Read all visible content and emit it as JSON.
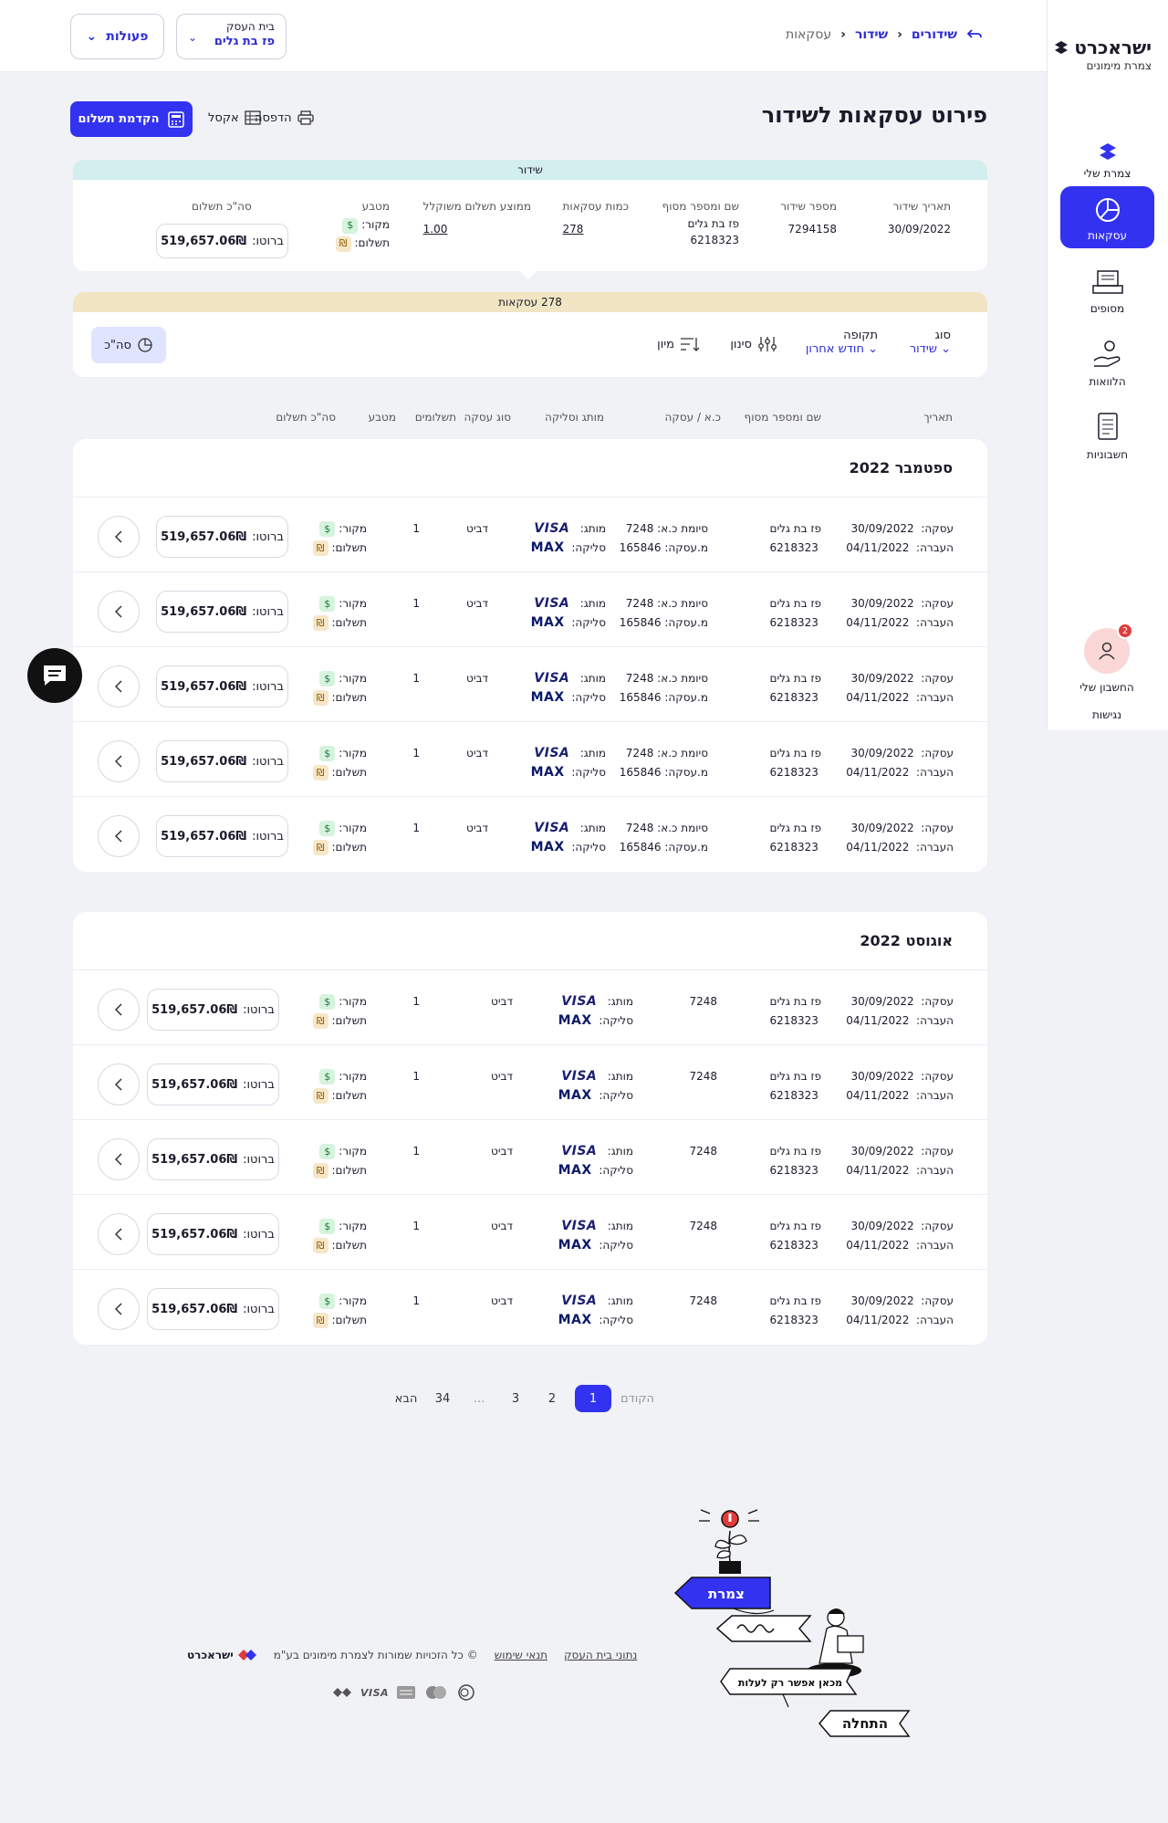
{
  "sidebar": {
    "logo_title": "ישראכרט",
    "logo_sub": "צמרת מימונים",
    "items": [
      {
        "label": "צמרת שלי",
        "icon": "layers-icon"
      },
      {
        "label": "עסקאות",
        "icon": "pie-chart-icon"
      },
      {
        "label": "מסופים",
        "icon": "terminal-icon"
      },
      {
        "label": "הלוואות",
        "icon": "loan-hand-icon"
      },
      {
        "label": "חשבוניות",
        "icon": "invoice-icon"
      }
    ],
    "account_label": "החשבון שלי",
    "account_badge": "2",
    "accessibility": "נגישות"
  },
  "header": {
    "breadcrumb": [
      "שידורים",
      "שידור",
      "עסקאות"
    ],
    "business_label": "בית העסק",
    "business_value": "פז בת גלים",
    "actions_label": "פעולות"
  },
  "toolbar": {
    "title": "פירוט עסקאות לשידור",
    "print": "הדפסה",
    "excel": "אקסל",
    "advance": "הקדמת תשלום"
  },
  "summary": {
    "header": "שידור",
    "date_h": "תאריך שידור",
    "date_v": "30/09/2022",
    "num_h": "מספר שידור",
    "num_v": "7294158",
    "terminal_h": "שם ומספר מסוף",
    "terminal_v1": "פז בת גלים",
    "terminal_v2": "6218323",
    "count_h": "כמות עסקאות",
    "count_v": "278",
    "avg_h": "ממוצע תשלום משוקלל",
    "avg_v": "1.00",
    "currency_h": "מטבע",
    "source": "מקור:",
    "payment": "תשלום:",
    "dollar": "$",
    "shekel": "₪",
    "total_h": "סה\"כ תשלום",
    "gross": "ברוטו:",
    "total_v": "519,657.06₪"
  },
  "filters": {
    "header": "278 עסקאות",
    "type_h": "סוג",
    "type_v": "שידור",
    "period_h": "תקופה",
    "period_v": "חודש אחרון",
    "filter": "סינון",
    "sort": "מיון",
    "total": "סה\"כ"
  },
  "columns": [
    "תאריך",
    "שם ומספר מסוף",
    "כ.א / עסקה",
    "מותג וסליקה",
    "סוג עסקה",
    "תשלומים",
    "מטבע",
    "סה\"כ תשלום"
  ],
  "row_labels": {
    "deal": "עסקה:",
    "transfer": "העברה:",
    "card_end": "סיומת כ.א:",
    "deal_no": "מ.עסקה:",
    "brand": "מותג:",
    "clearing": "סליקה:",
    "visa": "VISA",
    "max": "MAX",
    "source": "מקור:",
    "payment": "תשלום:",
    "gross": "ברוטו:",
    "dollar": "$",
    "shekel": "₪"
  },
  "months": [
    {
      "title": "ספטמבר 2022",
      "rows": [
        {
          "deal_date": "30/09/2022",
          "transfer_date": "04/11/2022",
          "terminal": "פז בת גלים",
          "terminal_no": "6218323",
          "card_end": "7248",
          "deal_no": "165846",
          "type": "דביט",
          "payments": "1",
          "amount": "519,657.06₪"
        },
        {
          "deal_date": "30/09/2022",
          "transfer_date": "04/11/2022",
          "terminal": "פז בת גלים",
          "terminal_no": "6218323",
          "card_end": "7248",
          "deal_no": "165846",
          "type": "דביט",
          "payments": "1",
          "amount": "519,657.06₪"
        },
        {
          "deal_date": "30/09/2022",
          "transfer_date": "04/11/2022",
          "terminal": "פז בת גלים",
          "terminal_no": "6218323",
          "card_end": "7248",
          "deal_no": "165846",
          "type": "דביט",
          "payments": "1",
          "amount": "519,657.06₪"
        },
        {
          "deal_date": "30/09/2022",
          "transfer_date": "04/11/2022",
          "terminal": "פז בת גלים",
          "terminal_no": "6218323",
          "card_end": "7248",
          "deal_no": "165846",
          "type": "דביט",
          "payments": "1",
          "amount": "519,657.06₪"
        },
        {
          "deal_date": "30/09/2022",
          "transfer_date": "04/11/2022",
          "terminal": "פז בת גלים",
          "terminal_no": "6218323",
          "card_end": "7248",
          "deal_no": "165846",
          "type": "דביט",
          "payments": "1",
          "amount": "519,657.06₪"
        }
      ]
    },
    {
      "title": "אוגוסט 2022",
      "rows": [
        {
          "deal_date": "30/09/2022",
          "transfer_date": "04/11/2022",
          "terminal": "פז בת גלים",
          "terminal_no": "6218323",
          "card_end": "7248",
          "type": "דביט",
          "payments": "1",
          "amount": "519,657.06₪"
        },
        {
          "deal_date": "30/09/2022",
          "transfer_date": "04/11/2022",
          "terminal": "פז בת גלים",
          "terminal_no": "6218323",
          "card_end": "7248",
          "type": "דביט",
          "payments": "1",
          "amount": "519,657.06₪"
        },
        {
          "deal_date": "30/09/2022",
          "transfer_date": "04/11/2022",
          "terminal": "פז בת גלים",
          "terminal_no": "6218323",
          "card_end": "7248",
          "type": "דביט",
          "payments": "1",
          "amount": "519,657.06₪"
        },
        {
          "deal_date": "30/09/2022",
          "transfer_date": "04/11/2022",
          "terminal": "פז בת גלים",
          "terminal_no": "6218323",
          "card_end": "7248",
          "type": "דביט",
          "payments": "1",
          "amount": "519,657.06₪"
        },
        {
          "deal_date": "30/09/2022",
          "transfer_date": "04/11/2022",
          "terminal": "פז בת גלים",
          "terminal_no": "6218323",
          "card_end": "7248",
          "type": "דביט",
          "payments": "1",
          "amount": "519,657.06₪"
        }
      ]
    }
  ],
  "pagination": {
    "prev": "הקודם",
    "pages": [
      "1",
      "2",
      "3",
      "...",
      "34"
    ],
    "next": "הבא",
    "current": "1"
  },
  "footer": {
    "biz_data": "נתוני בית העסק",
    "terms": "תנאי שימוש",
    "copyright": "© כל הזכויות שמורות לצמרת מימונים בע\"מ",
    "logo": "ישראכרט",
    "cards": [
      "diners-icon",
      "mastercard-icon",
      "amex-icon",
      "visa-icon",
      "generic-card-icon"
    ],
    "visa_text": "VISA"
  },
  "illustration": {
    "sign1": "צמרת",
    "sign3": "מכאן אפשר רק לעלות",
    "sign4": "התחלה",
    "accent": "#3232f0"
  },
  "colors": {
    "accent": "#3232f0",
    "summary_header": "#d3eeee",
    "filter_header": "#f1e5c3",
    "badge": "#e23b3b"
  }
}
